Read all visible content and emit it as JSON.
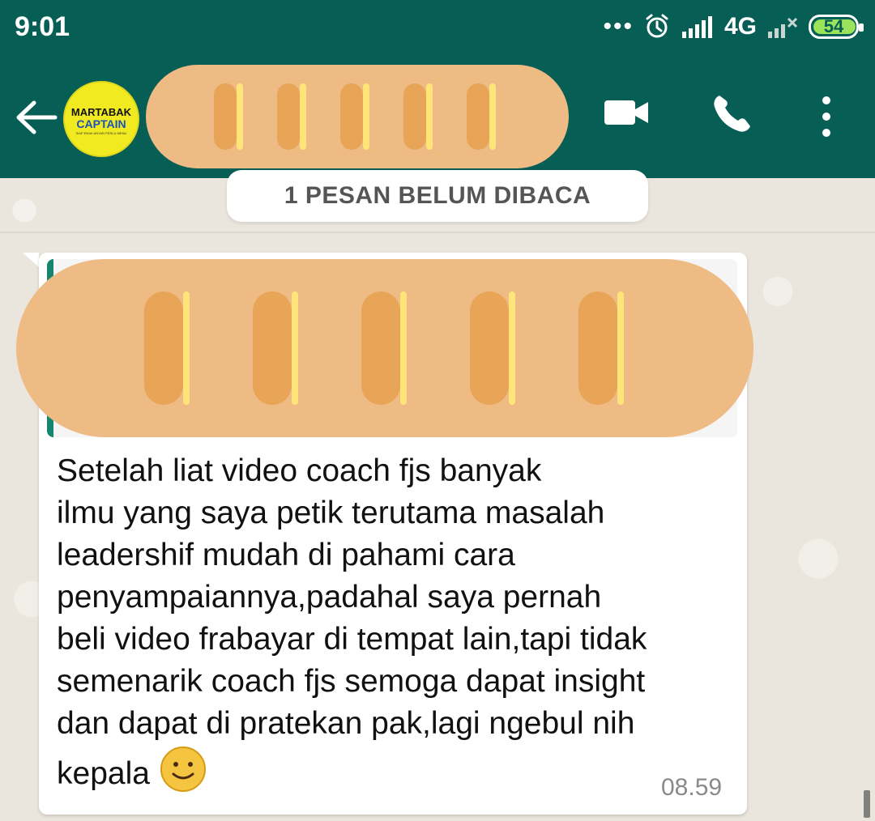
{
  "status_bar": {
    "time": "9:01",
    "network": "4G",
    "battery": "54",
    "icons": [
      "notification-dots-icon",
      "alarm-icon",
      "signal-icon",
      "network-4g-icon",
      "signal-no-service-icon",
      "battery-icon"
    ]
  },
  "header": {
    "contact_name": "",
    "avatar_text_top": "MARTABAK",
    "avatar_text_bottom": "CAPTAIN",
    "avatar_tagline": "SIAP ENAK ANYAR PERLU MENU",
    "icons": [
      "back-arrow-icon",
      "video-call-icon",
      "voice-call-icon",
      "more-options-icon"
    ]
  },
  "chat": {
    "unread_banner": "1 PESAN BELUM DIBACA",
    "message": {
      "quoted_text": "",
      "text_lines": [
        "Setelah liat video coach fjs banyak",
        "ilmu yang saya petik terutama masalah",
        "leadershif mudah di pahami cara",
        "penyampaiannya,padahal saya pernah",
        "beli video frabayar di tempat lain,tapi tidak",
        "semenarik coach fjs semoga dapat insight",
        "dan dapat di pratekan pak,lagi ngebul nih",
        "kepala"
      ],
      "timestamp": "08.59",
      "emoji": "smiling-face-icon"
    }
  },
  "colors": {
    "header": "#075e54",
    "accent": "#16856d",
    "chat_background": "#ebe6dd",
    "bubble": "#ffffff",
    "redaction": "#efbb84"
  }
}
